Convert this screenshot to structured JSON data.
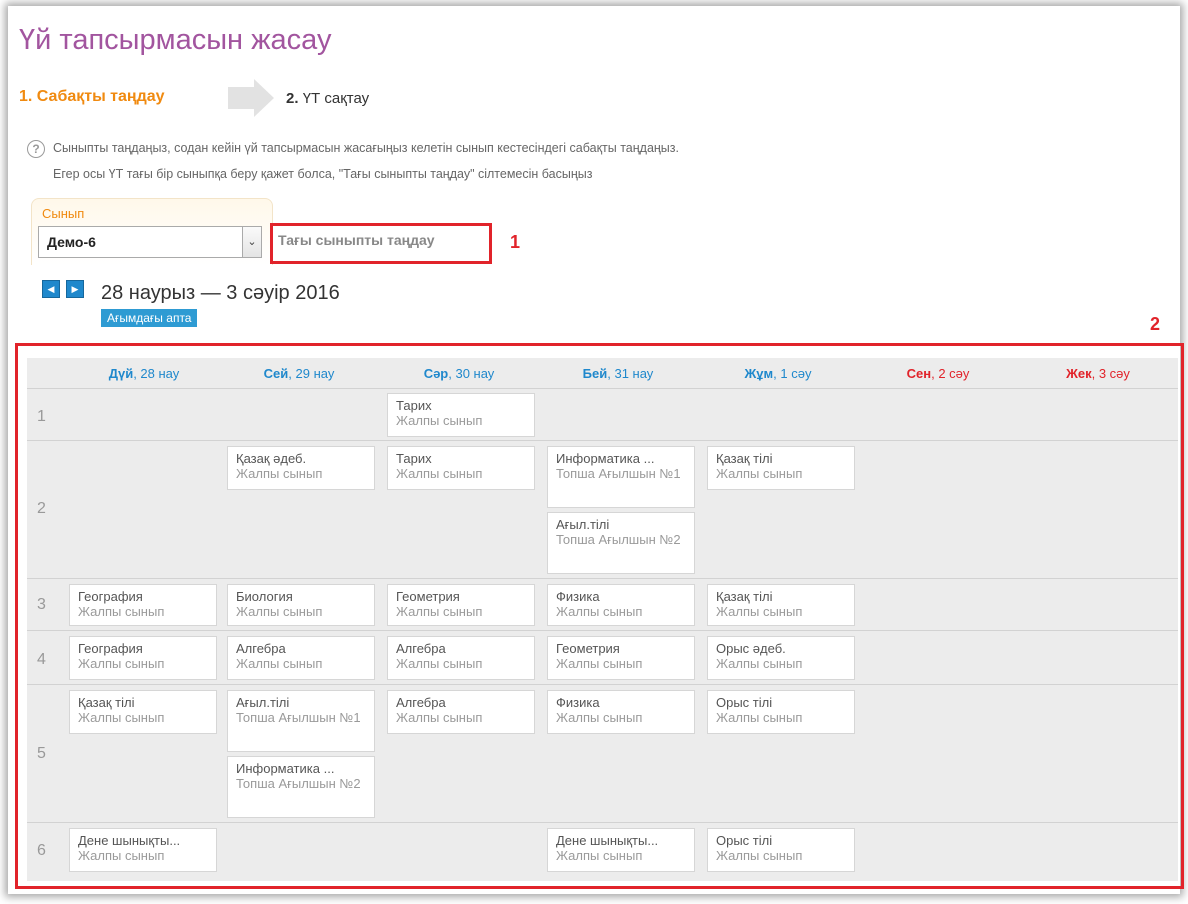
{
  "page": {
    "title": "Үй тапсырмасын жасау",
    "step1": "1. Сабақты таңдау",
    "step2_num": "2.",
    "step2_label": "ҮТ сақтау",
    "help_line1": "Сыныпты таңдаңыз, содан кейін үй тапсырмасын жасағыңыз келетін сынып кестесіндегі сабақты таңдаңыз.",
    "help_line2": "Егер осы ҮТ тағы бір сыныпқа беру қажет болса, \"Тағы сыныпты таңдау\" сілтемесін басыңыз"
  },
  "class_selector": {
    "label": "Сынып",
    "value": "Демо-6",
    "more_link": "Тағы сыныпты таңдау"
  },
  "annotations": {
    "one": "1",
    "two": "2"
  },
  "week": {
    "range": "28 наурыз — 3 сәуір 2016",
    "current_badge": "Ағымдағы апта",
    "days": [
      {
        "short": "Дүй",
        "date": ", 28 нау",
        "weekend": false
      },
      {
        "short": "Сей",
        "date": ", 29 нау",
        "weekend": false
      },
      {
        "short": "Сәр",
        "date": ", 30 нау",
        "weekend": false
      },
      {
        "short": "Бей",
        "date": ", 31 нау",
        "weekend": false
      },
      {
        "short": "Жұм",
        "date": ", 1 сәу",
        "weekend": false
      },
      {
        "short": "Сен",
        "date": ", 2 сәу",
        "weekend": true
      },
      {
        "short": "Жек",
        "date": ", 3 сәу",
        "weekend": true
      }
    ]
  },
  "schedule": {
    "rows": [
      "1",
      "2",
      "3",
      "4",
      "5",
      "6"
    ],
    "lessons": [
      {
        "subject": "Тарих",
        "group": "Жалпы сынып"
      },
      {
        "subject": "Қазақ әдеб.",
        "group": "Жалпы сынып"
      },
      {
        "subject": "Тарих",
        "group": "Жалпы сынып"
      },
      {
        "subject": "Информатика ...",
        "group": "Топша Ағылшын №1"
      },
      {
        "subject": "Ағыл.тілі",
        "group": "Топша Ағылшын №2"
      },
      {
        "subject": "Қазақ тілі",
        "group": "Жалпы сынып"
      },
      {
        "subject": "География",
        "group": "Жалпы сынып"
      },
      {
        "subject": "Биология",
        "group": "Жалпы сынып"
      },
      {
        "subject": "Геометрия",
        "group": "Жалпы сынып"
      },
      {
        "subject": "Физика",
        "group": "Жалпы сынып"
      },
      {
        "subject": "Қазақ тілі",
        "group": "Жалпы сынып"
      },
      {
        "subject": "География",
        "group": "Жалпы сынып"
      },
      {
        "subject": "Алгебра",
        "group": "Жалпы сынып"
      },
      {
        "subject": "Алгебра",
        "group": "Жалпы сынып"
      },
      {
        "subject": "Геометрия",
        "group": "Жалпы сынып"
      },
      {
        "subject": "Орыс әдеб.",
        "group": "Жалпы сынып"
      },
      {
        "subject": "Қазақ тілі",
        "group": "Жалпы сынып"
      },
      {
        "subject": "Ағыл.тілі",
        "group": "Топша Ағылшын №1"
      },
      {
        "subject": "Алгебра",
        "group": "Жалпы сынып"
      },
      {
        "subject": "Физика",
        "group": "Жалпы сынып"
      },
      {
        "subject": "Орыс тілі",
        "group": "Жалпы сынып"
      },
      {
        "subject": "Информатика ...",
        "group": "Топша Ағылшын №2"
      },
      {
        "subject": "Дене шынықты...",
        "group": "Жалпы сынып"
      },
      {
        "subject": "Дене шынықты...",
        "group": "Жалпы сынып"
      },
      {
        "subject": "Орыс тілі",
        "group": "Жалпы сынып"
      }
    ]
  },
  "colors": {
    "title": "#a2559f",
    "step_active": "#f08a10",
    "accent_blue": "#1f88cc",
    "weekend_red": "#e1232a"
  }
}
